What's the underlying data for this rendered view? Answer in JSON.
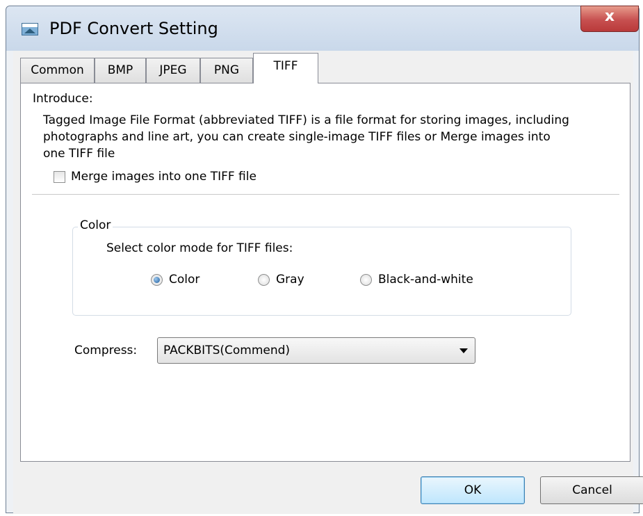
{
  "window": {
    "title": "PDF Convert Setting",
    "close_label": "x"
  },
  "tabs": [
    {
      "label": "Common",
      "active": false
    },
    {
      "label": "BMP",
      "active": false
    },
    {
      "label": "JPEG",
      "active": false
    },
    {
      "label": "PNG",
      "active": false
    },
    {
      "label": "TIFF",
      "active": true
    }
  ],
  "tiff": {
    "introduce_label": "Introduce:",
    "introduce_text": "Tagged Image File Format (abbreviated TIFF) is a file format for storing images, including photographs and line art, you can create single-image TIFF files or Merge images into one TIFF file",
    "merge_checkbox_label": "Merge images into one TIFF file",
    "merge_checked": false,
    "color_group": {
      "title": "Color",
      "prompt": "Select color mode for TIFF files:",
      "options": [
        "Color",
        "Gray",
        "Black-and-white"
      ],
      "selected": "Color"
    },
    "compress": {
      "label": "Compress:",
      "value": "PACKBITS(Commend)"
    }
  },
  "buttons": {
    "ok": "OK",
    "cancel": "Cancel"
  },
  "colors": {
    "title_bar": "#c9d8ea",
    "close_button": "#c75050",
    "panel": "#ffffff",
    "dialog_bg": "#f0f0f0",
    "ok_button": "#bee6fd"
  }
}
